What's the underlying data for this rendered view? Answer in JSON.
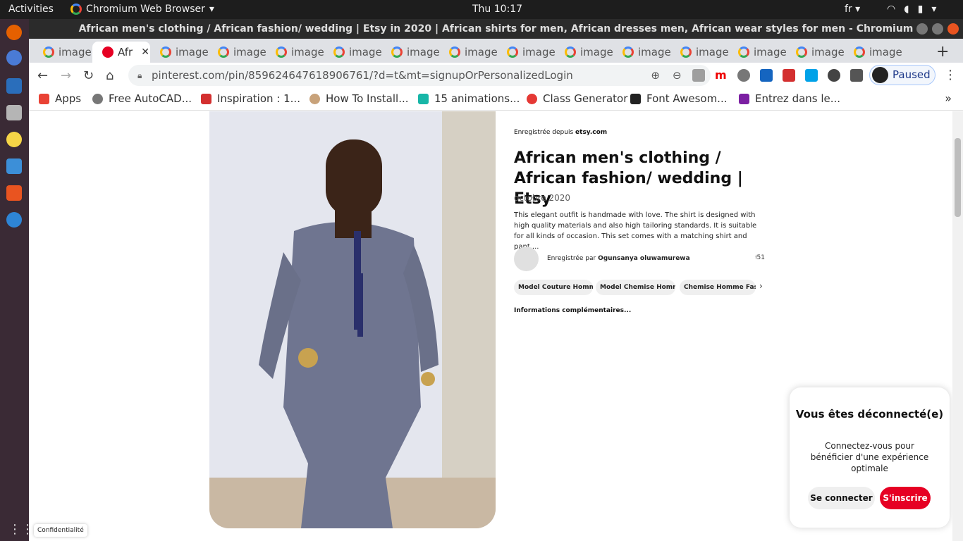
{
  "system_bar": {
    "activities": "Activities",
    "app_name": "Chromium Web Browser",
    "clock": "Thu 10:17",
    "language": "fr"
  },
  "window": {
    "title": "African men's clothing / African fashion/ wedding | Etsy in 2020 | African shirts for men, African dresses men, African wear styles for men - Chromium"
  },
  "tabs": {
    "inactive_label": "image",
    "active_label": "Afr",
    "new_tab": "+"
  },
  "address_bar": {
    "url": "pinterest.com/pin/859624647618906761/?d=t&mt=signupOrPersonalizedLogin"
  },
  "profile": {
    "label": "Paused"
  },
  "bookmarks": [
    "Apps",
    "Free AutoCAD...",
    "Inspiration : 1...",
    "How To Install...",
    "15 animations...",
    "Class Generator",
    "Font Awesom...",
    "Entrez dans le..."
  ],
  "pin": {
    "saved_from_prefix": "Enregistrée depuis ",
    "saved_from_site": "etsy.com",
    "title": "African men's clothing / African fashion/ wedding | Etsy",
    "date": "octobre 2020",
    "description": "This elegant outfit is handmade with love. The shirt is designed with high quality materials and also high tailoring standards. It is suitable for all kinds of occasion. This set comes with a matching shirt and pant....",
    "saved_by_prefix": "Enregistrée par ",
    "saved_by_name": "Ogunsanya oluwamurewa",
    "save_count": "51",
    "tags": [
      "Model Couture Homme",
      "Model Chemise Homme",
      "Chemise Homme Fashion"
    ],
    "more_info": "Informations complémentaires..."
  },
  "privacy_link": "Confidentialité",
  "login_toast": {
    "title": "Vous êtes déconnecté(e)",
    "body": "Connectez-vous pour bénéficier d'une expérience optimale",
    "login_button": "Se connecter",
    "signup_button": "S'inscrire"
  },
  "colors": {
    "pinterest_red": "#e60023",
    "chrome_tab_strip": "#dfe1e5",
    "ubuntu_dock": "#3a2a35"
  }
}
